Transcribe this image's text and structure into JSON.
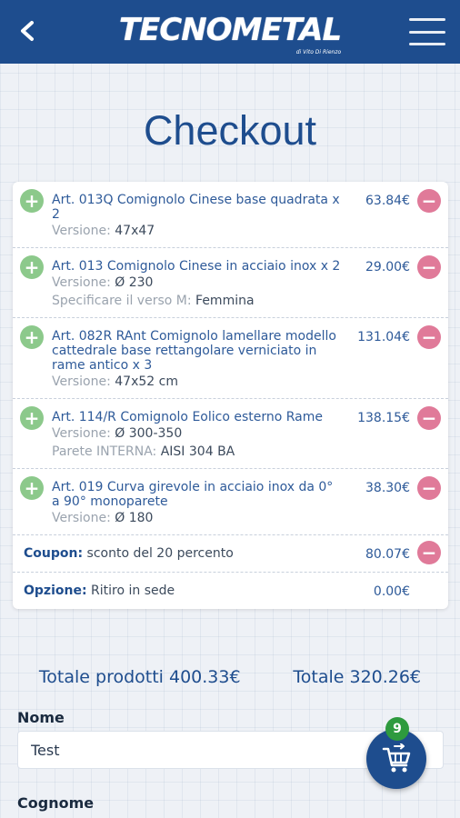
{
  "header": {
    "logo": "TECNOMETAL",
    "logo_sub": "di Vito Di Rienzo"
  },
  "page_title": "Checkout",
  "items": [
    {
      "title": "Art. 013Q Comignolo Cinese base quadrata x 2",
      "price": "63.84€",
      "meta": [
        {
          "label": "Versione:",
          "value": "47x47"
        }
      ]
    },
    {
      "title": "Art. 013 Comignolo Cinese in acciaio inox x 2",
      "price": "29.00€",
      "meta": [
        {
          "label": "Versione:",
          "value": "Ø 230"
        },
        {
          "label": "Specificare il verso M:",
          "value": "Femmina"
        }
      ]
    },
    {
      "title": "Art. 082R RAnt Comignolo lamellare modello cattedrale base rettangolare verniciato in rame antico x 3",
      "price": "131.04€",
      "meta": [
        {
          "label": "Versione:",
          "value": "47x52 cm"
        }
      ]
    },
    {
      "title": "Art. 114/R Comignolo Eolico esterno Rame",
      "price": "138.15€",
      "meta": [
        {
          "label": "Versione:",
          "value": "Ø 300-350"
        },
        {
          "label": "Parete INTERNA:",
          "value": "AISI 304 BA"
        }
      ]
    },
    {
      "title": "Art. 019 Curva girevole in acciaio inox da 0° a 90° monoparete",
      "price": "38.30€",
      "meta": [
        {
          "label": "Versione:",
          "value": "Ø 180"
        }
      ]
    }
  ],
  "coupon": {
    "label": "Coupon:",
    "text": "sconto del 20 percento",
    "price": "80.07€"
  },
  "option": {
    "label": "Opzione:",
    "text": "Ritiro in sede",
    "price": "0.00€"
  },
  "totals": {
    "products": "Totale prodotti 400.33€",
    "total": "Totale 320.26€"
  },
  "form": {
    "nome_label": "Nome",
    "nome_value": "Test",
    "cognome_label": "Cognome"
  },
  "cart": {
    "count": "9"
  },
  "colors": {
    "primary": "#1e4d8e",
    "plus": "#8cc98b",
    "minus": "#e07a99",
    "badge": "#2e9a3e"
  }
}
